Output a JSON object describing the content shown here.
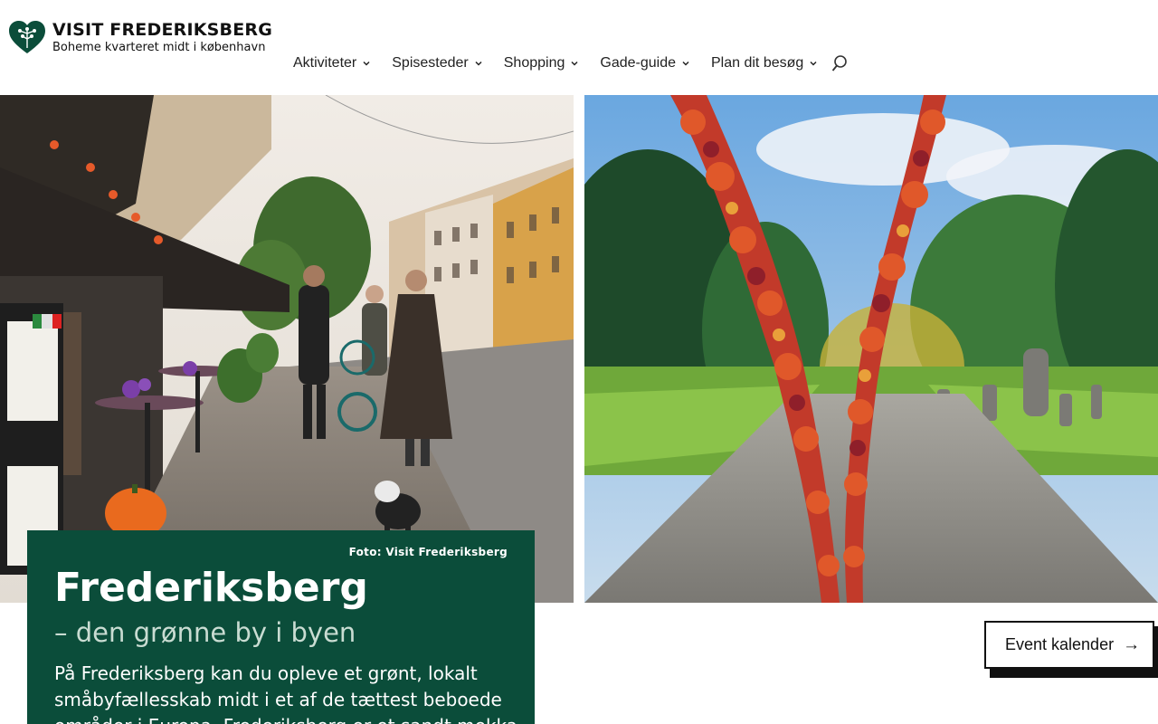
{
  "logo": {
    "title": "VISIT FREDERIKSBERG",
    "subtitle": "Boheme kvarteret midt i københavn",
    "color": "#0b4d3a"
  },
  "nav": {
    "items": [
      {
        "label": "Aktiviteter",
        "has_dropdown": true
      },
      {
        "label": "Spisesteder",
        "has_dropdown": true
      },
      {
        "label": "Shopping",
        "has_dropdown": true
      },
      {
        "label": "Gade-guide",
        "has_dropdown": true
      },
      {
        "label": "Plan dit besøg",
        "has_dropdown": true
      }
    ],
    "search_icon": "search-icon"
  },
  "hero": {
    "left_image": "street-cafe-photo",
    "right_image": "autumn-vine-park-photo"
  },
  "card": {
    "credit": "Foto: Visit Frederiksberg",
    "title": "Frederiksberg",
    "subtitle": "– den grønne by i byen",
    "body": "På Frederiksberg kan du opleve et grønt, lokalt småbyfællesskab midt i et af de tættest beboede områder i Europa. Frederiksberg er et sandt mekka",
    "background": "#0b4d3a"
  },
  "event_button": {
    "label": "Event kalender",
    "arrow": "→"
  }
}
